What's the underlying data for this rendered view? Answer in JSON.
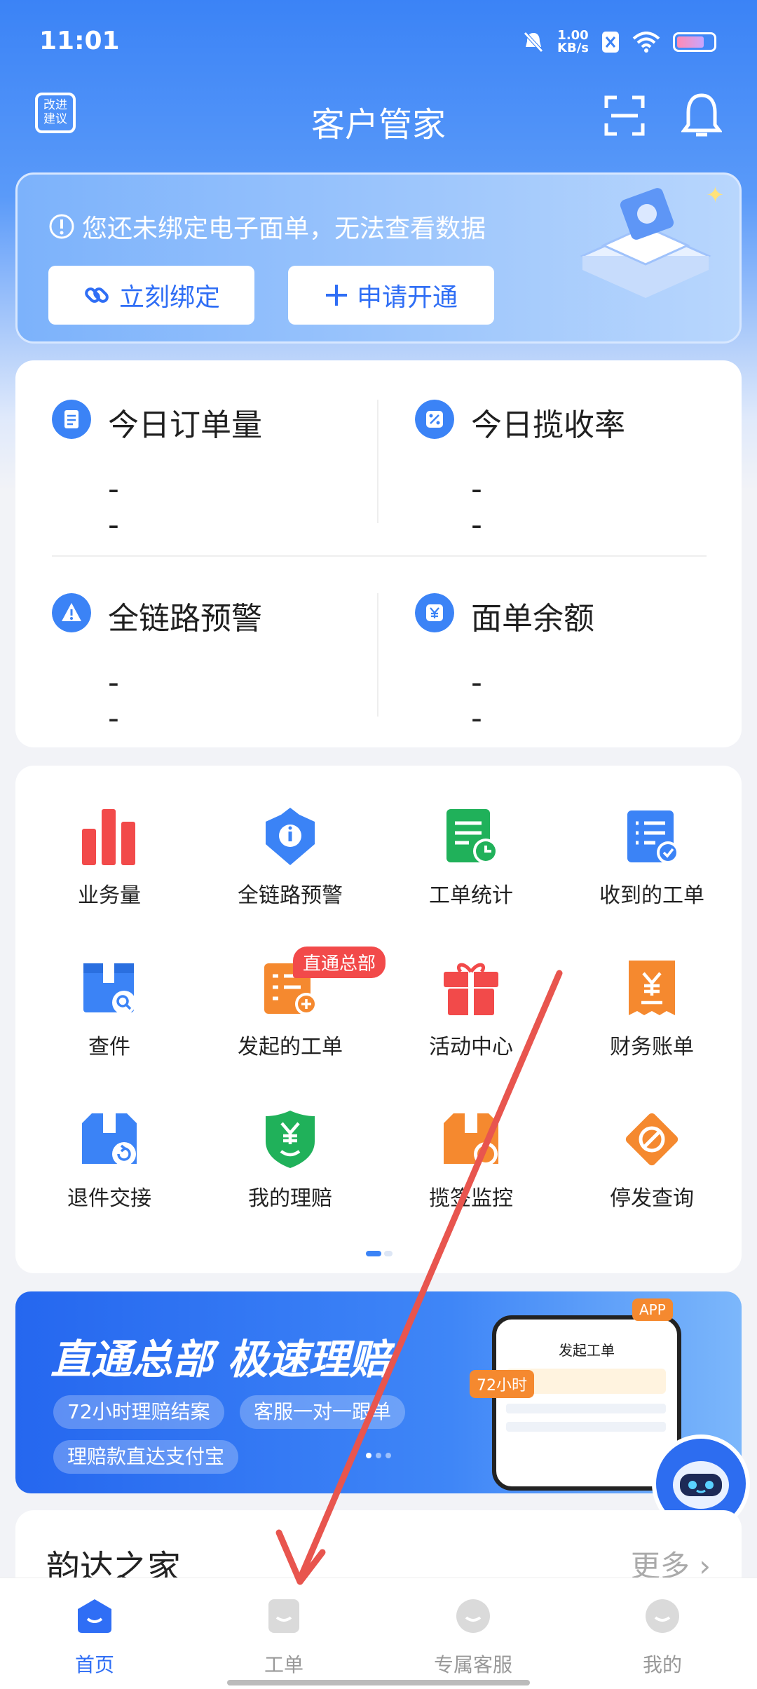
{
  "status": {
    "time": "11:01",
    "speed_value": "1.00",
    "speed_unit": "KB/s"
  },
  "header": {
    "suggest_line1": "改进",
    "suggest_line2": "建议",
    "title": "客户管家"
  },
  "bind": {
    "message": "您还未绑定电子面单，无法查看数据",
    "bind_button": "立刻绑定",
    "apply_button": "申请开通"
  },
  "stats": [
    {
      "label": "今日订单量",
      "value": "--"
    },
    {
      "label": "今日揽收率",
      "value": "--"
    },
    {
      "label": "全链路预警",
      "value": "--"
    },
    {
      "label": "面单余额",
      "value": "--"
    }
  ],
  "grid": [
    {
      "label": "业务量",
      "icon": "bar-chart-icon",
      "color": "#f24a4a"
    },
    {
      "label": "全链路预警",
      "icon": "alert-shield-icon",
      "color": "#3b83f6"
    },
    {
      "label": "工单统计",
      "icon": "report-clock-icon",
      "color": "#20b15a"
    },
    {
      "label": "收到的工单",
      "icon": "clipboard-check-icon",
      "color": "#3b83f6"
    },
    {
      "label": "查件",
      "icon": "package-search-icon",
      "color": "#3b83f6"
    },
    {
      "label": "发起的工单",
      "icon": "form-plus-icon",
      "color": "#f5892f",
      "badge": "直通总部"
    },
    {
      "label": "活动中心",
      "icon": "gift-icon",
      "color": "#f24a4a"
    },
    {
      "label": "财务账单",
      "icon": "receipt-yuan-icon",
      "color": "#f5892f"
    },
    {
      "label": "退件交接",
      "icon": "package-return-icon",
      "color": "#3b83f6"
    },
    {
      "label": "我的理赔",
      "icon": "shield-yuan-icon",
      "color": "#20b15a"
    },
    {
      "label": "揽签监控",
      "icon": "package-monitor-icon",
      "color": "#f5892f"
    },
    {
      "label": "停发查询",
      "icon": "stop-diamond-icon",
      "color": "#f5892f"
    }
  ],
  "banner": {
    "title": "直通总部  极速理赔",
    "chips": [
      "72小时理赔结案",
      "客服一对一跟单",
      "理赔款直达支付宝"
    ],
    "phone_title": "发起工单",
    "app_tag": "APP",
    "hours_tag": "72小时"
  },
  "home": {
    "title": "韵达之家",
    "more": "更多"
  },
  "tabs": [
    {
      "label": "首页",
      "icon": "home-icon",
      "active": true
    },
    {
      "label": "工单",
      "icon": "workorder-icon",
      "active": false
    },
    {
      "label": "专属客服",
      "icon": "service-icon",
      "active": false
    },
    {
      "label": "我的",
      "icon": "profile-icon",
      "active": false
    }
  ],
  "colors": {
    "brand": "#2f6ef5",
    "annotation_arrow": "#e8554e"
  }
}
